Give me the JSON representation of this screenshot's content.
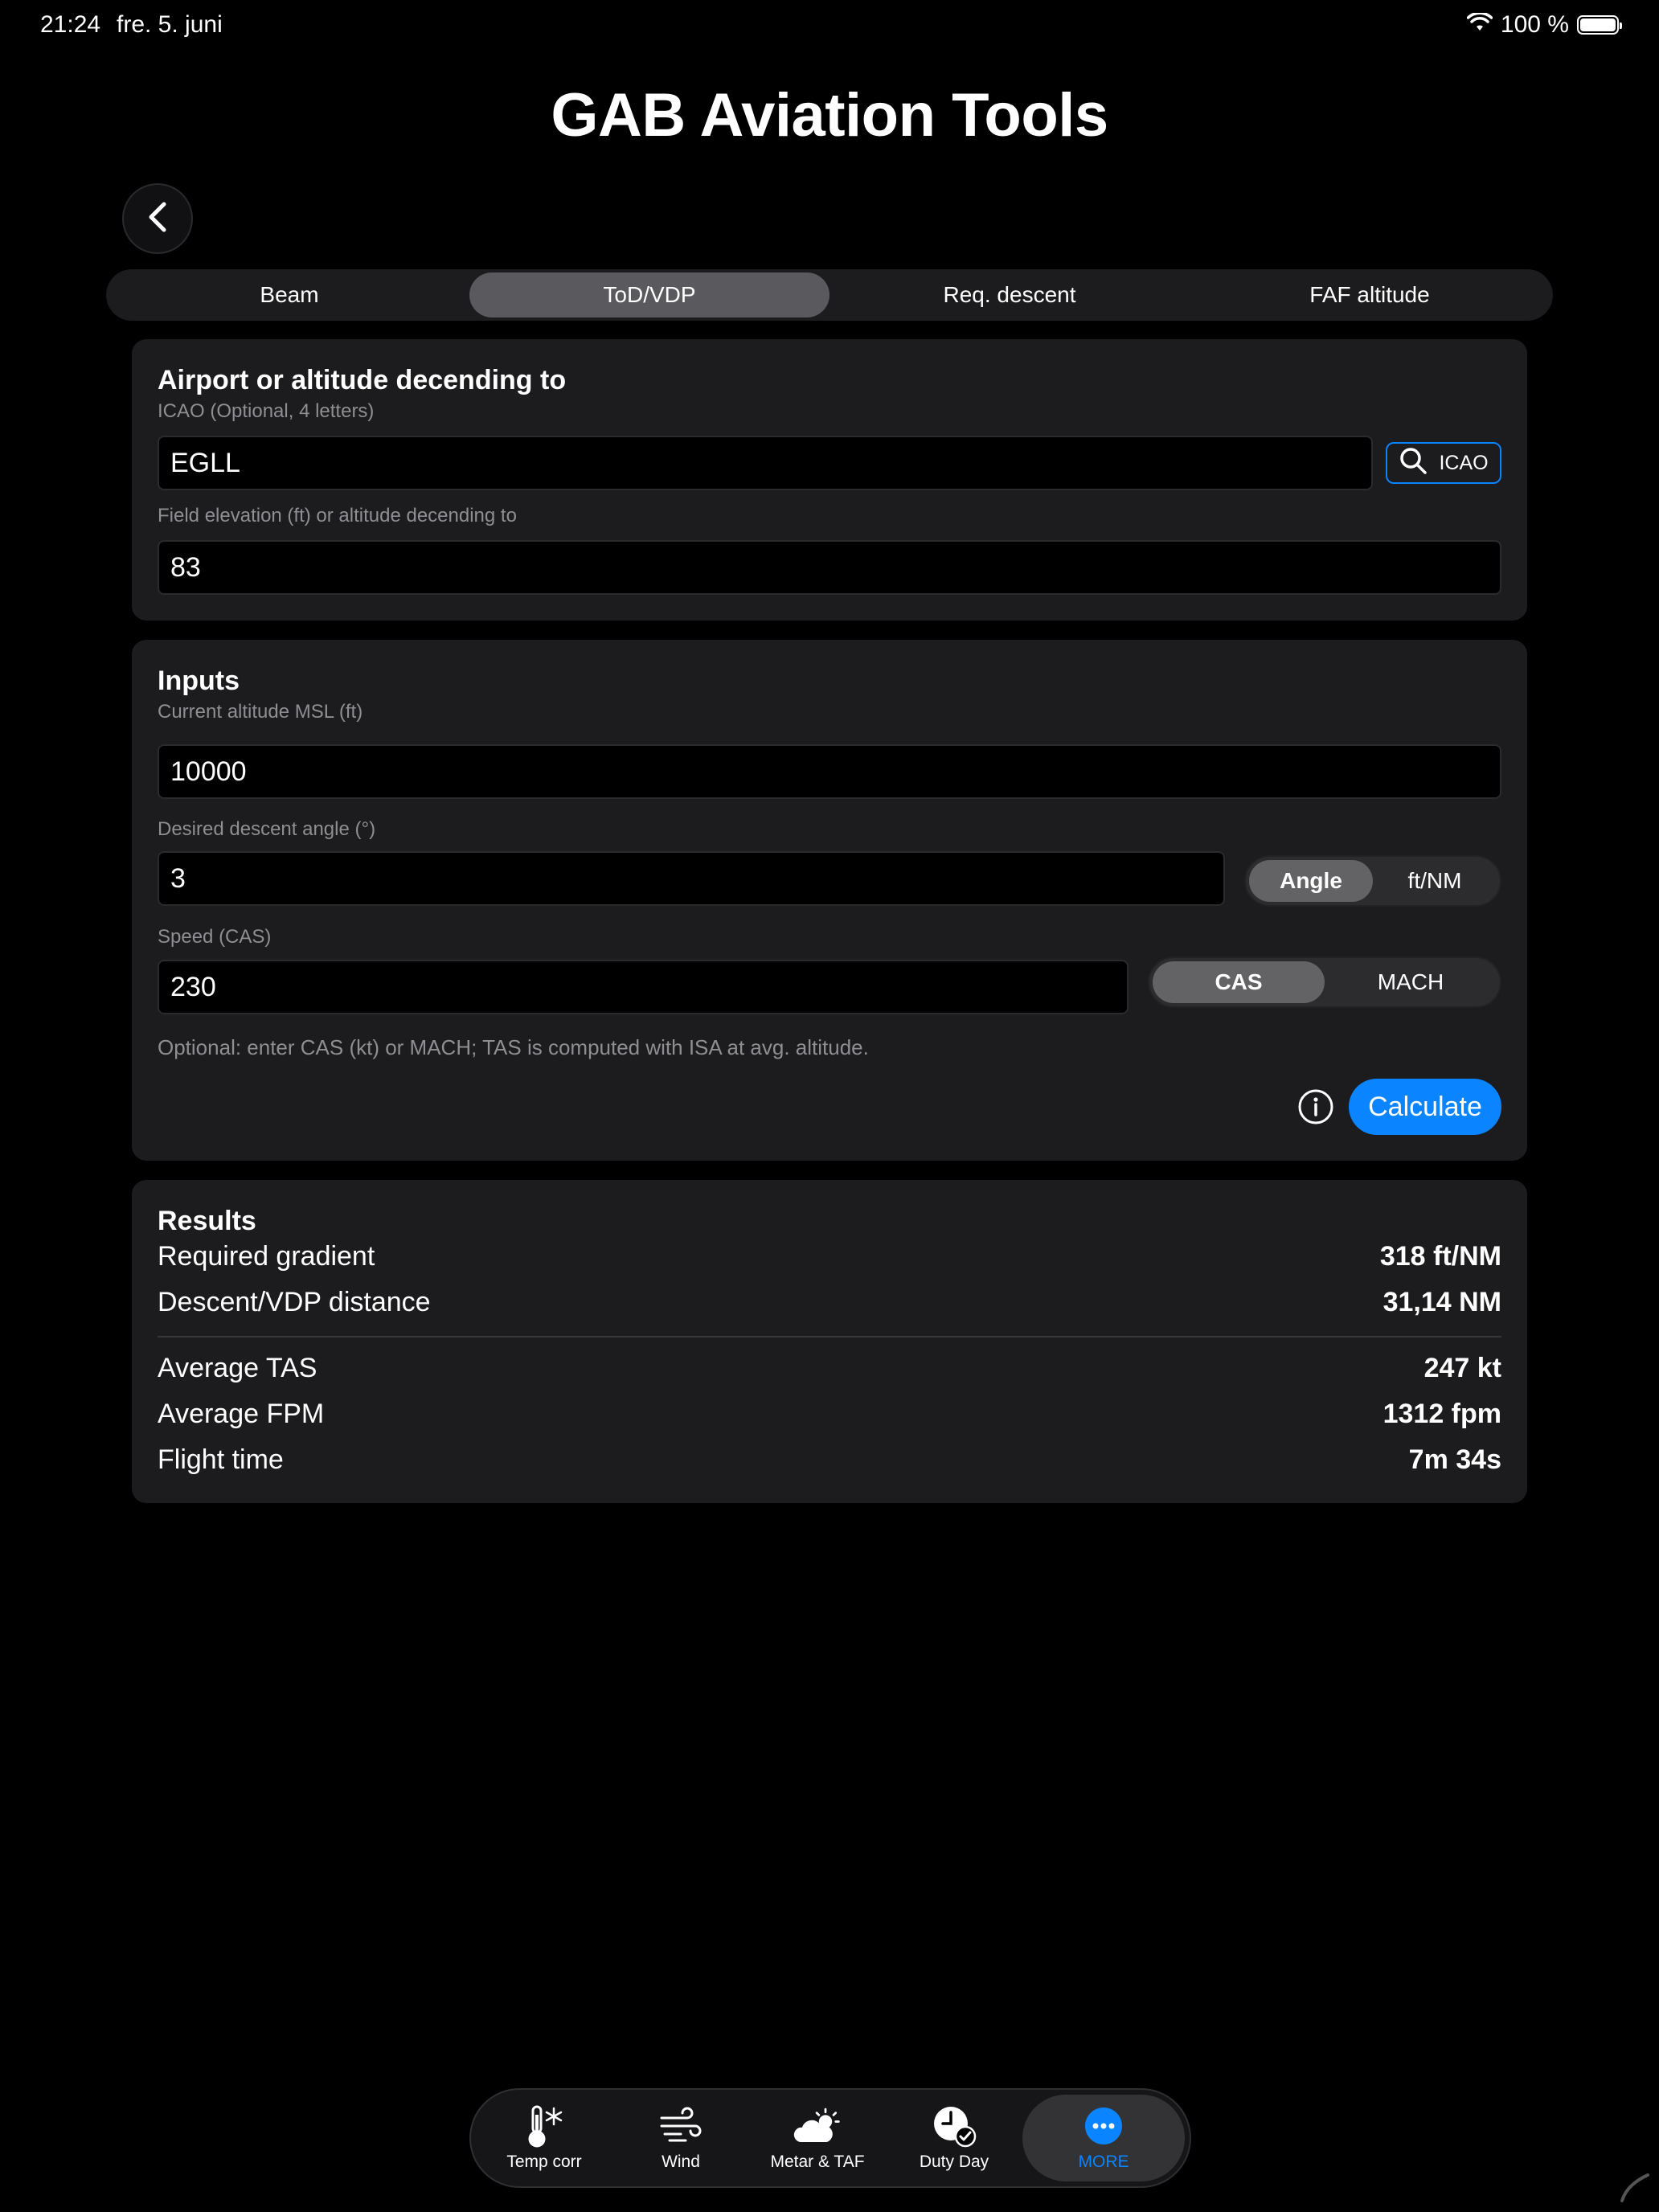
{
  "status": {
    "time": "21:24",
    "date": "fre. 5. juni",
    "battery": "100 %"
  },
  "app": {
    "title": "GAB Aviation Tools"
  },
  "tabs": [
    {
      "label": "Beam",
      "active": false
    },
    {
      "label": "ToD/VDP",
      "active": true
    },
    {
      "label": "Req. descent",
      "active": false
    },
    {
      "label": "FAF altitude",
      "active": false
    }
  ],
  "airport_card": {
    "title": "Airport or altitude decending to",
    "icao_label": "ICAO (Optional, 4 letters)",
    "icao_value": "EGLL",
    "icao_button": "ICAO",
    "elevation_label": "Field elevation (ft) or altitude decending to",
    "elevation_value": "83"
  },
  "inputs_card": {
    "title": "Inputs",
    "altitude_label": "Current altitude MSL (ft)",
    "altitude_value": "10000",
    "angle_label": "Desired descent angle (°)",
    "angle_value": "3",
    "angle_mode": {
      "options": [
        "Angle",
        "ft/NM"
      ],
      "selected": "Angle"
    },
    "speed_label": "Speed (CAS)",
    "speed_value": "230",
    "speed_mode": {
      "options": [
        "CAS",
        "MACH"
      ],
      "selected": "CAS"
    },
    "hint": "Optional: enter CAS (kt) or MACH; TAS is computed with ISA at avg. altitude.",
    "calculate_label": "Calculate"
  },
  "results_card": {
    "title": "Results",
    "rows": [
      {
        "label": "Required gradient",
        "value": "318 ft/NM"
      },
      {
        "label": "Descent/VDP distance",
        "value": "31,14 NM"
      },
      {
        "label": "Average TAS",
        "value": "247 kt"
      },
      {
        "label": "Average FPM",
        "value": "1312 fpm"
      },
      {
        "label": "Flight time",
        "value": "7m 34s"
      }
    ]
  },
  "tab_bar": {
    "items": [
      {
        "label": "Temp corr",
        "icon": "thermometer-snowflake-icon"
      },
      {
        "label": "Wind",
        "icon": "wind-icon"
      },
      {
        "label": "Metar & TAF",
        "icon": "cloud-sun-icon"
      },
      {
        "label": "Duty Day",
        "icon": "clock-check-icon"
      },
      {
        "label": "MORE",
        "icon": "more-ellipsis-icon",
        "active": true
      }
    ]
  },
  "colors": {
    "accent": "#0a84ff",
    "card": "#1c1c1e",
    "background": "#000000",
    "secondary_text": "#8e8e93"
  }
}
